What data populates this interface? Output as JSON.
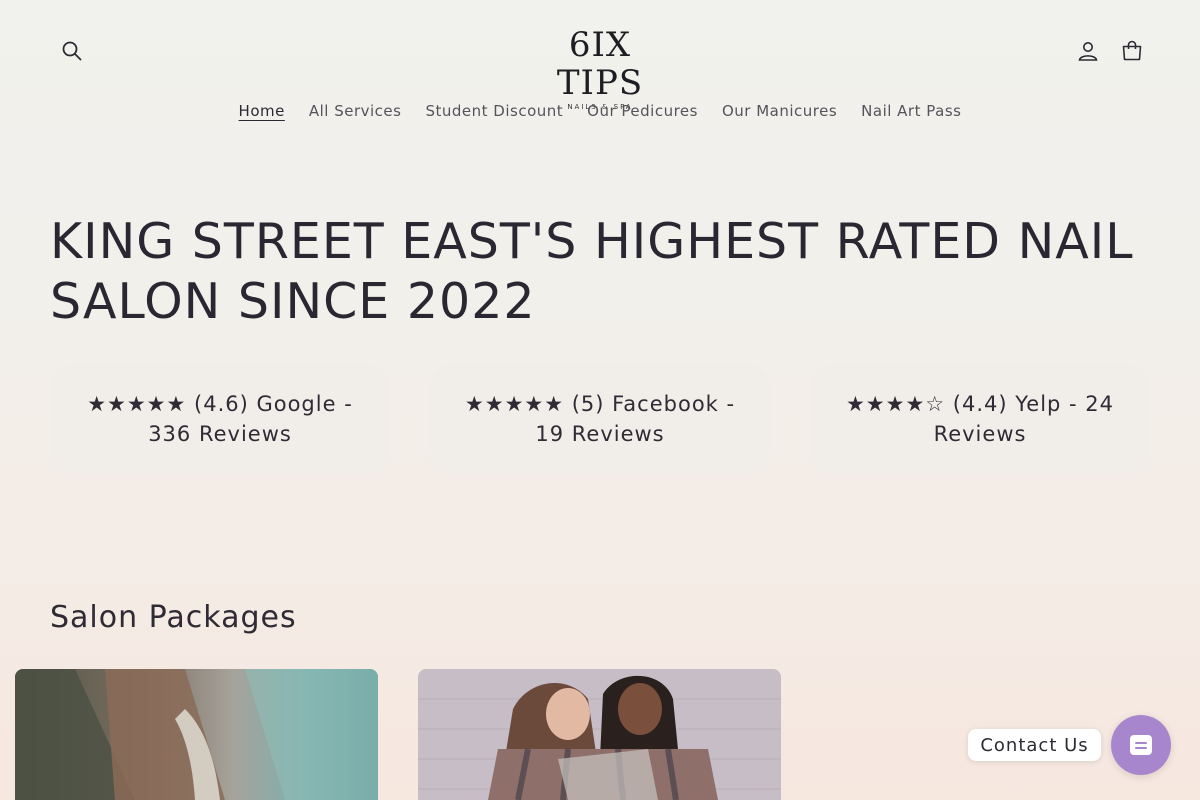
{
  "header": {
    "logo": {
      "main": "6IX TIPS",
      "sub": "NAILS & SPA"
    },
    "icons": {
      "search": "search-icon",
      "account": "account-icon",
      "cart": "cart-icon"
    }
  },
  "nav": {
    "items": [
      {
        "label": "Home",
        "active": true
      },
      {
        "label": "All Services"
      },
      {
        "label": "Student Discount"
      },
      {
        "label": "Our Pedicures"
      },
      {
        "label": "Our Manicures"
      },
      {
        "label": "Nail Art Pass"
      }
    ]
  },
  "hero": {
    "title": "KING STREET EAST'S HIGHEST RATED NAIL SALON SINCE 2022"
  },
  "reviews": [
    {
      "text": "★★★★★ (4.6) Google - 336 Reviews"
    },
    {
      "text": "★★★★★ (5) Facebook - 19 Reviews"
    },
    {
      "text": "★★★★☆ (4.4) Yelp - 24 Reviews"
    }
  ],
  "packages": {
    "title": "Salon Packages"
  },
  "contact": {
    "label": "Contact Us",
    "icon": "chat-icon",
    "color": "#a886cd"
  }
}
